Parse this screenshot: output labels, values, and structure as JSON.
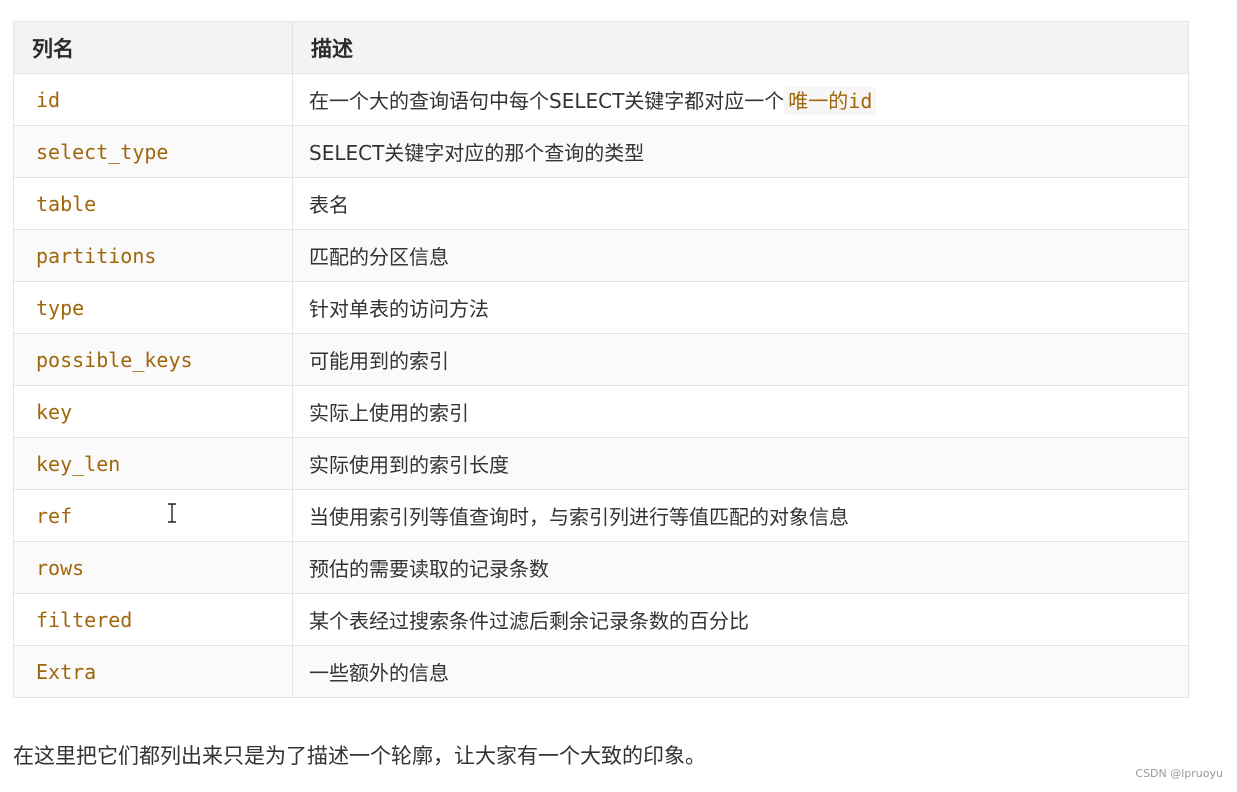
{
  "table": {
    "headers": [
      "列名",
      "描述"
    ],
    "rows": [
      {
        "name": "id",
        "desc": "在一个大的查询语句中每个SELECT关键字都对应一个",
        "desc_code": "唯一的id"
      },
      {
        "name": "select_type",
        "desc": "SELECT关键字对应的那个查询的类型"
      },
      {
        "name": "table",
        "desc": "表名"
      },
      {
        "name": "partitions",
        "desc": "匹配的分区信息"
      },
      {
        "name": "type",
        "desc": "针对单表的访问方法"
      },
      {
        "name": "possible_keys",
        "desc": "可能用到的索引"
      },
      {
        "name": "key",
        "desc": "实际上使用的索引"
      },
      {
        "name": "key_len",
        "desc": "实际使用到的索引长度"
      },
      {
        "name": "ref",
        "desc": "当使用索引列等值查询时，与索引列进行等值匹配的对象信息"
      },
      {
        "name": "rows",
        "desc": "预估的需要读取的记录条数"
      },
      {
        "name": "filtered",
        "desc": "某个表经过搜索条件过滤后剩余记录条数的百分比"
      },
      {
        "name": "Extra",
        "desc": "一些额外的信息"
      }
    ]
  },
  "summary": "在这里把它们都列出来只是为了描述一个轮廓，让大家有一个大致的印象。",
  "watermark": "CSDN @lpruoyu",
  "colors": {
    "code_text": "#a0660b",
    "header_bg": "#f3f3f3",
    "border": "#e4e4e4"
  },
  "icons": {
    "cursor": "text-cursor-icon"
  }
}
